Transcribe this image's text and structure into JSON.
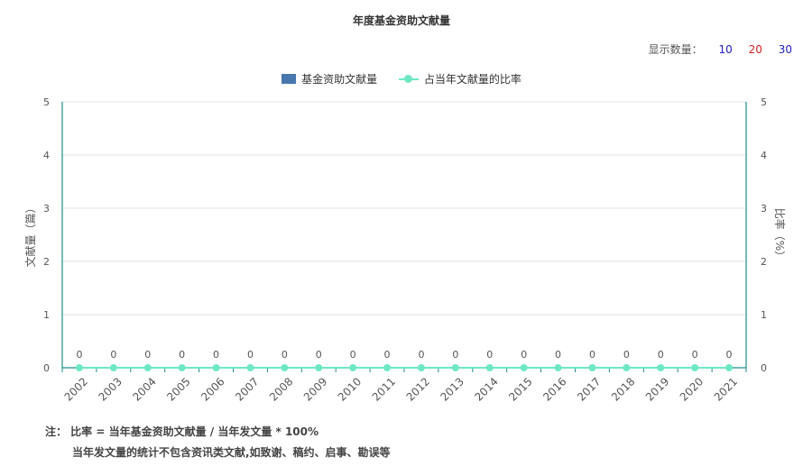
{
  "chart_data": {
    "type": "bar",
    "title": "年度基金资助文献量",
    "categories": [
      "2002",
      "2003",
      "2004",
      "2005",
      "2006",
      "2007",
      "2008",
      "2009",
      "2010",
      "2011",
      "2012",
      "2013",
      "2014",
      "2015",
      "2016",
      "2017",
      "2018",
      "2019",
      "2020",
      "2021"
    ],
    "series": [
      {
        "name": "基金资助文献量",
        "type": "bar",
        "color": "#4777ad",
        "values": [
          0,
          0,
          0,
          0,
          0,
          0,
          0,
          0,
          0,
          0,
          0,
          0,
          0,
          0,
          0,
          0,
          0,
          0,
          0,
          0
        ]
      },
      {
        "name": "占当年文献量的比率",
        "type": "line",
        "color": "#6ee8c4",
        "values": [
          0,
          0,
          0,
          0,
          0,
          0,
          0,
          0,
          0,
          0,
          0,
          0,
          0,
          0,
          0,
          0,
          0,
          0,
          0,
          0
        ]
      }
    ],
    "data_labels": [
      "0",
      "0",
      "0",
      "0",
      "0",
      "0",
      "0",
      "0",
      "0",
      "0",
      "0",
      "0",
      "0",
      "0",
      "0",
      "0",
      "0",
      "0",
      "0",
      "0"
    ],
    "ylabel": "文献量（篇）",
    "y2label": "比率（%）",
    "ylim": [
      0,
      5
    ],
    "y2lim": [
      0,
      5
    ],
    "yticks": [
      "0",
      "1",
      "2",
      "3",
      "4",
      "5"
    ],
    "grid": true,
    "legend_position": "top-center"
  },
  "display_count": {
    "label": "显示数量：",
    "options": [
      "10",
      "20",
      "30"
    ],
    "colors": [
      "#2020c0",
      "#d02020",
      "#2020c0"
    ]
  },
  "notes": {
    "line1": "注：  比率 = 当年基金资助文献量 / 当年发文量 * 100%",
    "line2": "当年发文量的统计不包含资讯类文献,如致谢、稿约、启事、勘误等"
  }
}
